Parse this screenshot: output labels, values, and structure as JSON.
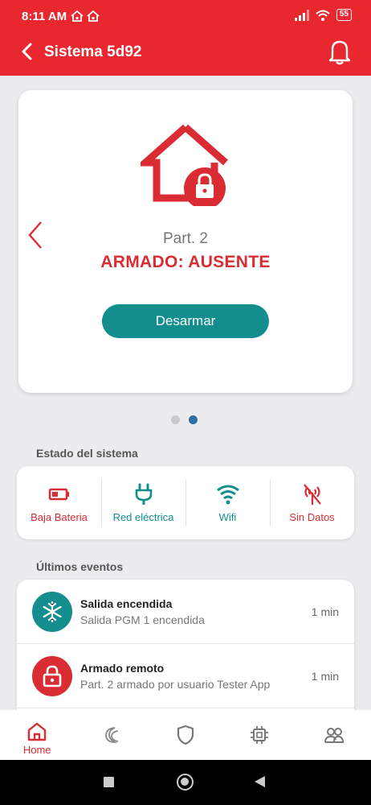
{
  "status_bar": {
    "time": "8:11 AM",
    "battery": "55"
  },
  "header": {
    "title": "Sistema 5d92"
  },
  "partition_card": {
    "partition": "Part. 2",
    "state": "ARMADO: AUSENTE",
    "action_label": "Desarmar",
    "page_count": 2,
    "active_page": 2
  },
  "system_status": {
    "title": "Estado del sistema",
    "items": [
      {
        "label": "Baja Bateria",
        "icon": "battery-low-icon",
        "color": "red"
      },
      {
        "label": "Red eléctrica",
        "icon": "power-plug-icon",
        "color": "teal"
      },
      {
        "label": "Wifi",
        "icon": "wifi-icon",
        "color": "teal"
      },
      {
        "label": "Sin Datos",
        "icon": "no-signal-icon",
        "color": "red"
      }
    ]
  },
  "events": {
    "title": "Últimos eventos",
    "items": [
      {
        "title": "Salida encendida",
        "subtitle": "Salida PGM 1 encendida",
        "time": "1 min",
        "icon": "snowflake-icon"
      },
      {
        "title": "Armado remoto",
        "subtitle": "Part. 2 armado por usuario Tester App",
        "time": "1 min",
        "icon": "lock-icon"
      }
    ]
  },
  "bottom_nav": [
    {
      "label": "Home",
      "icon": "home-icon",
      "active": true
    },
    {
      "label": "",
      "icon": "night-mode-icon"
    },
    {
      "label": "",
      "icon": "shield-icon"
    },
    {
      "label": "",
      "icon": "chip-icon"
    },
    {
      "label": "",
      "icon": "users-icon"
    }
  ],
  "colors": {
    "brand_red": "#e8282e",
    "alert_red": "#d92d33",
    "teal": "#138d8d",
    "active_dot": "#2f6fa8"
  }
}
